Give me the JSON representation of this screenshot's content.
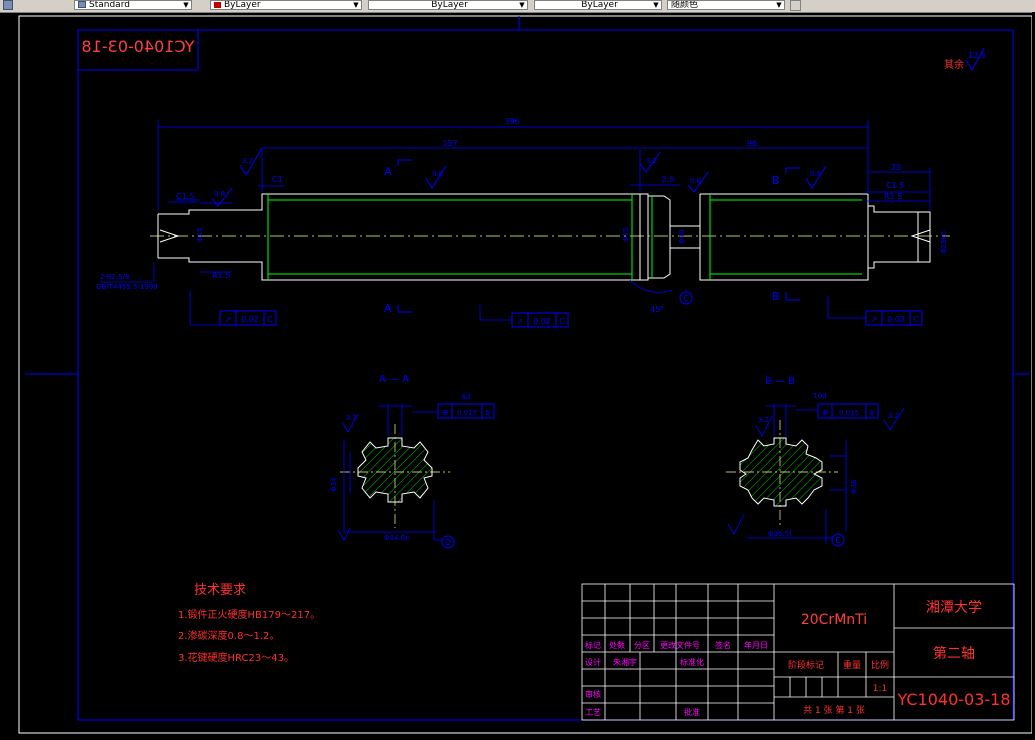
{
  "toolbar": {
    "text_style": "Standard",
    "color": "ByLayer",
    "linetype": "ByLayer",
    "lineweight": "ByLayer",
    "plot_style": "随颜色"
  },
  "drawing": {
    "corner_code": "YC1040-03-18",
    "surface_roughness_rest_label": "其余",
    "surface_roughness_rest_value": "12.5",
    "dimensions": {
      "overall_length": "396",
      "left_section_length": "157",
      "right_section_length": "96",
      "right_end_length": "23",
      "groove_width": "2.5",
      "chamfer_c15_left": "C1.5",
      "chamfer_c15_right": "C1.5",
      "chamfer_c1": "C1",
      "fillet_r15_left": "R1.5",
      "fillet_r15_right": "R1.5",
      "angle_45": "45°",
      "center_hole": "2-B2.5/8",
      "center_hole_standard": "GB/T4459.5-1999",
      "left_diameter": "Φ25",
      "shaft_diameter": "Φ35",
      "right_diameter": "Φ40",
      "right_end_diameter": "Φ25k6"
    },
    "roughness": [
      "3.2",
      "0.8",
      "0.8",
      "0.8",
      "3.2",
      "0.8"
    ],
    "section_labels": {
      "a": "A",
      "b": "B",
      "c_datum": "C"
    },
    "tolerance_frames": [
      {
        "symbol": "↗",
        "value": "0.02",
        "datum": "C"
      },
      {
        "symbol": "↗",
        "value": "0.02",
        "datum": "C"
      },
      {
        "symbol": "↗",
        "value": "0.03",
        "datum": "C"
      }
    ],
    "section_aa": {
      "title": "A — A",
      "width": "6d",
      "depth_dim": "3.2",
      "tolerance": "0.015",
      "datum": "D",
      "outer_dia": "Φ34",
      "inner_dia": "Φ38.2h",
      "bottom_dim": "Φ34.6e",
      "datum_label": "D"
    },
    "section_bb": {
      "title": "B — B",
      "width": "10d",
      "depth_dim": "3.2",
      "tolerance": "0.015",
      "datum": "E",
      "rough": "3.2",
      "outer_dia": "Φ36",
      "bottom_dim": "Φ36.5f",
      "datum_label": "E"
    },
    "tech_req": {
      "title": "技术要求",
      "items": [
        "1.锻件正火硬度HB179～217。",
        "2.渗碳深度0.8～1.2。",
        "3.花键硬度HRC23～43。"
      ]
    },
    "title_block": {
      "material": "20CrMnTi",
      "school": "湘潭大学",
      "part_name": "第二轴",
      "drawing_no": "YC1040-03-18",
      "scale_label": "比例",
      "weight_label": "重量",
      "stage_label": "阶段标记",
      "scale_value": "1:1",
      "sheets": "共 1 张  第 1 张",
      "row_labels": [
        "标记",
        "处数",
        "分区",
        "更改文件号",
        "签名",
        "年月日"
      ],
      "design_label": "设计",
      "design_name": "朱湘宇",
      "standardize_label": "标准化",
      "review_label": "审核",
      "process_label": "工艺",
      "approve_label": "批准"
    }
  }
}
